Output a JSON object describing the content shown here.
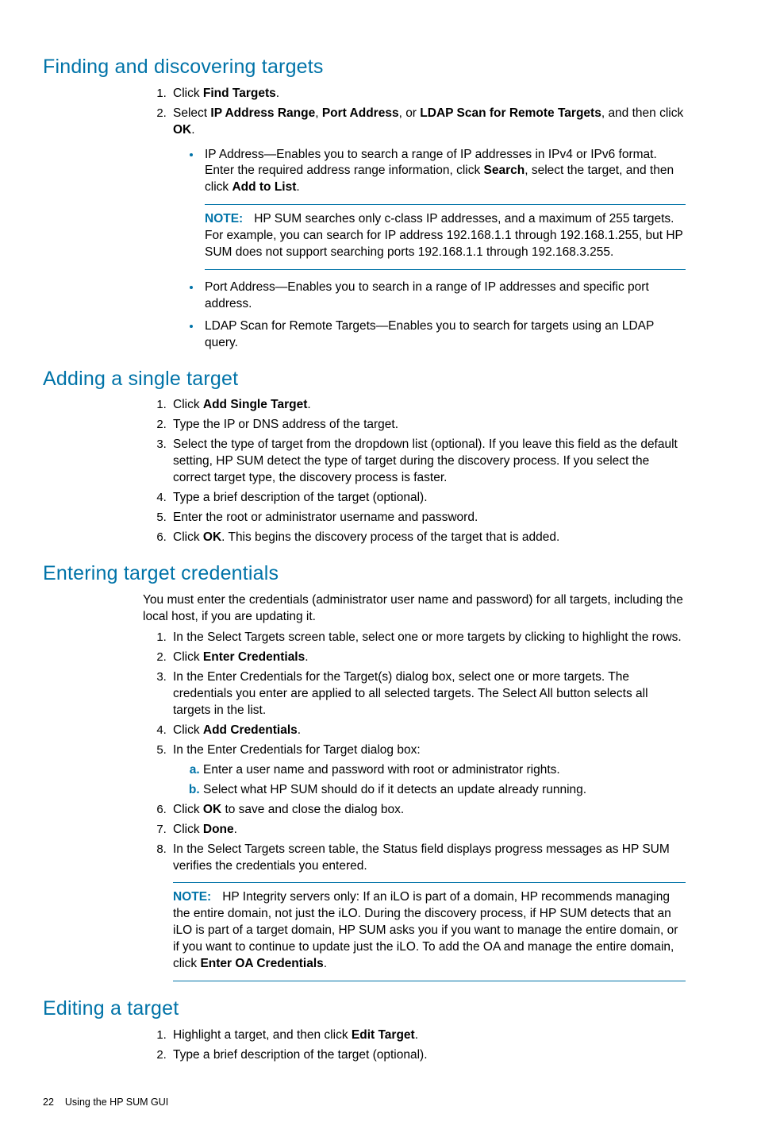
{
  "sections": {
    "finding": {
      "heading": "Finding and discovering targets",
      "step1_a": "Click ",
      "step1_b": "Find Targets",
      "step1_c": ".",
      "step2_a": "Select ",
      "step2_b": "IP Address Range",
      "step2_c": ", ",
      "step2_d": "Port Address",
      "step2_e": ", or ",
      "step2_f": "LDAP Scan for Remote Targets",
      "step2_g": ", and then click ",
      "step2_h": "OK",
      "step2_i": ".",
      "bullet1_a": "IP Address—Enables you to search a range of IP addresses in IPv4 or IPv6 format. Enter the required address range information, click ",
      "bullet1_b": "Search",
      "bullet1_c": ", select the target, and then click ",
      "bullet1_d": "Add to List",
      "bullet1_e": ".",
      "note_label": "NOTE:",
      "note_text": "HP SUM searches only c-class IP addresses, and a maximum of 255 targets. For example, you can search for IP address 192.168.1.1 through 192.168.1.255, but HP SUM does not support searching ports 192.168.1.1 through 192.168.3.255.",
      "bullet2": "Port Address—Enables you to search in a range of IP addresses and specific port address.",
      "bullet3": "LDAP Scan for Remote Targets—Enables you to search for targets using an LDAP query."
    },
    "adding": {
      "heading": "Adding a single target",
      "s1a": "Click ",
      "s1b": "Add Single Target",
      "s1c": ".",
      "s2": "Type the IP or DNS address of the target.",
      "s3": "Select the type of target from the dropdown list (optional). If you leave this field as the default setting, HP SUM detect the type of target during the discovery process. If you select the correct target type, the discovery process is faster.",
      "s4": "Type a brief description of the target (optional).",
      "s5": "Enter the root or administrator username and password.",
      "s6a": "Click ",
      "s6b": "OK",
      "s6c": ". This begins the discovery process of the target that is added."
    },
    "creds": {
      "heading": "Entering target credentials",
      "intro": "You must enter the credentials (administrator user name and password) for all targets, including the local host, if you are updating it.",
      "s1": "In the Select Targets screen table, select one or more targets by clicking to highlight the rows.",
      "s2a": "Click ",
      "s2b": "Enter Credentials",
      "s2c": ".",
      "s3": "In the Enter Credentials for the Target(s) dialog box, select one or more targets. The credentials you enter are applied to all selected targets. The Select All button selects all targets in the list.",
      "s4a": "Click ",
      "s4b": "Add Credentials",
      "s4c": ".",
      "s5": "In the Enter Credentials for Target dialog box:",
      "s5a": "Enter a user name and password with root or administrator rights.",
      "s5b": "Select what HP SUM should do if it detects an update already running.",
      "s6a": "Click ",
      "s6b": "OK",
      "s6c": " to save and close the dialog box.",
      "s7a": "Click ",
      "s7b": "Done",
      "s7c": ".",
      "s8": "In the Select Targets screen table, the Status field displays progress messages as HP SUM verifies the credentials you entered.",
      "note_label": "NOTE:",
      "note_a": "HP Integrity servers only: If an iLO is part of a domain, HP recommends managing the entire domain, not just the iLO. During the discovery process, if HP SUM detects that an iLO is part of a target domain, HP SUM asks you if you want to manage the entire domain, or if you want to continue to update just the iLO. To add the OA and manage the entire domain, click ",
      "note_b": "Enter OA Credentials",
      "note_c": "."
    },
    "editing": {
      "heading": "Editing a target",
      "s1a": "Highlight a target, and then click ",
      "s1b": "Edit Target",
      "s1c": ".",
      "s2": "Type a brief description of the target (optional)."
    }
  },
  "footer": {
    "page": "22",
    "title": "Using the HP SUM GUI"
  }
}
